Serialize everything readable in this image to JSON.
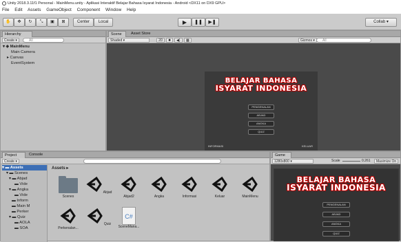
{
  "window": {
    "title": "Unity 2018.3.11f1 Personal - MainMenu.unity - Aplikasi Interaktif Belajar Bahasa Isyarat Indonesia - Android <DX11 on DX9 GPU>"
  },
  "menu": [
    "File",
    "Edit",
    "Assets",
    "GameObject",
    "Component",
    "Window",
    "Help"
  ],
  "toolbar": {
    "pivot": "Center",
    "space": "Local",
    "collab": "Collab"
  },
  "hierarchy": {
    "tab": "Hierarchy",
    "create": "Create",
    "search_placeholder": "All",
    "scene": "MainMenu",
    "items": [
      "Main Camera",
      "Canvas",
      "EventSystem"
    ]
  },
  "scene_view": {
    "tabs": [
      "Scene",
      "Asset Store"
    ],
    "shading": "Shaded",
    "mode2d": "2D",
    "gizmos": "Gizmos",
    "search_placeholder": "All"
  },
  "app": {
    "title_line1": "BELAJAR BAHASA",
    "title_line2": "ISYARAT INDONESIA",
    "buttons": [
      "PENGENALAN",
      "ABJAD",
      "ANGKA",
      "QUIZ"
    ],
    "footer_left": "INFORMASI",
    "footer_right": "KELUAR"
  },
  "project": {
    "tabs": [
      "Project",
      "Console"
    ],
    "create": "Create",
    "tree": [
      "Assets",
      "Scenes",
      "Abjad",
      "Vide",
      "Angka",
      "Vide",
      "Inform",
      "Main M",
      "Perker",
      "Quiz",
      "AOLA",
      "SOA"
    ],
    "breadcrumb": "Assets",
    "assets": [
      "Scenes",
      "Abjad",
      "Abjad2",
      "Angka",
      "Informasi",
      "Keluar",
      "MainMenu",
      "Perkenalan...",
      "Quiz",
      "SceneMana..."
    ]
  },
  "game": {
    "tab": "Game",
    "resolution": "1280x800",
    "scale_label": "Scale",
    "scale_value": "0.261",
    "maximize": "Maximize On"
  },
  "colors": {
    "accent_title": "#b00000",
    "unity_bg": "#c2c2c2"
  }
}
